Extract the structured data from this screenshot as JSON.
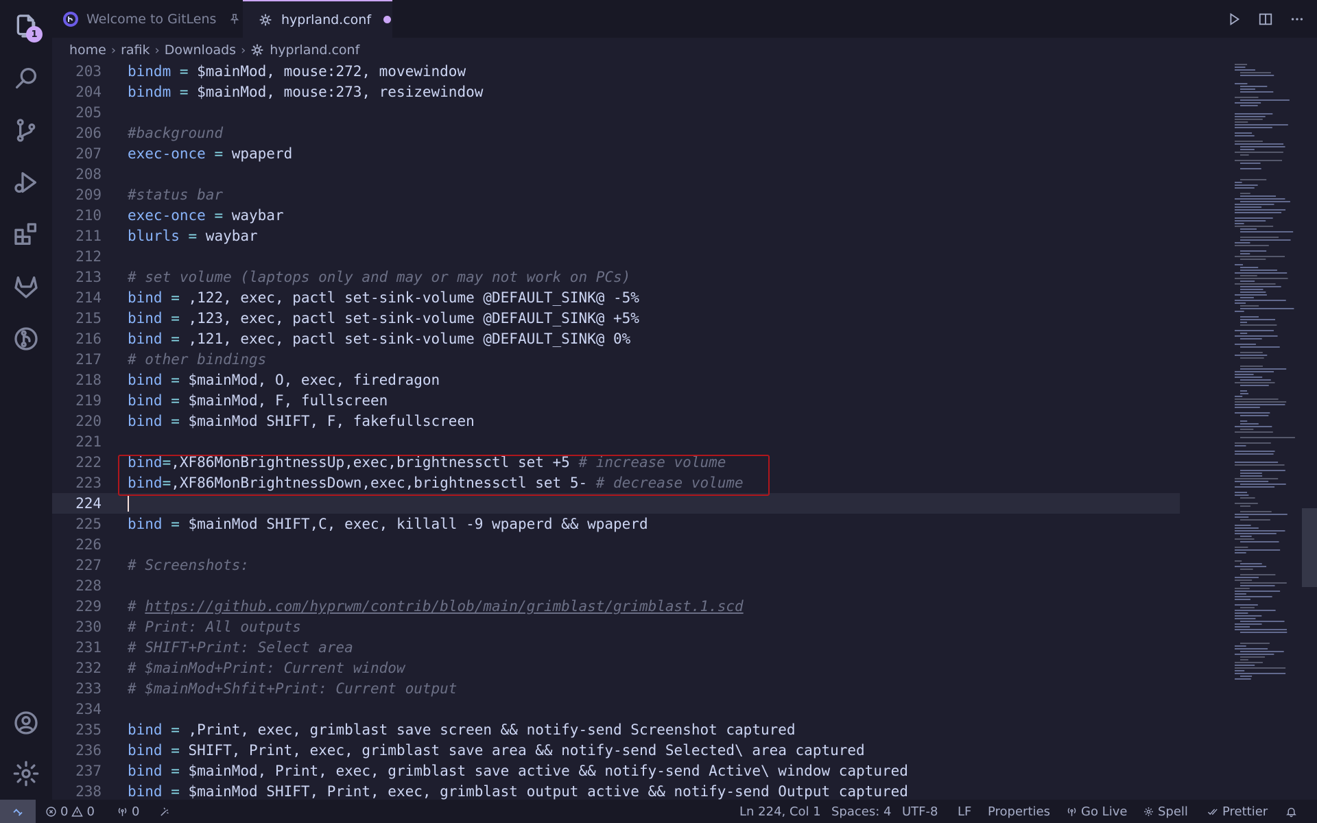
{
  "activity_bar": {
    "items": [
      "explorer",
      "search",
      "source-control",
      "run-and-debug",
      "extensions",
      "gitlab",
      "gitlens",
      "accounts",
      "manage"
    ],
    "explorer_badge": "1"
  },
  "tabs": [
    {
      "label": "Welcome to GitLens",
      "active": false,
      "pinned": true
    },
    {
      "label": "hyprland.conf",
      "active": true,
      "dirty": true
    }
  ],
  "breadcrumb": [
    "home",
    "rafik",
    "Downloads",
    "hyprland.conf"
  ],
  "editor": {
    "current_line": 224,
    "lines": [
      {
        "n": "203",
        "tokens": [
          {
            "t": "bindm",
            "c": "kw"
          },
          {
            "t": " = ",
            "c": "op"
          },
          {
            "t": "$mainMod, mouse:272, movewindow",
            "c": "tx"
          }
        ]
      },
      {
        "n": "204",
        "tokens": [
          {
            "t": "bindm",
            "c": "kw"
          },
          {
            "t": " = ",
            "c": "op"
          },
          {
            "t": "$mainMod, mouse:273, resizewindow",
            "c": "tx"
          }
        ]
      },
      {
        "n": "205",
        "tokens": []
      },
      {
        "n": "206",
        "tokens": [
          {
            "t": "#background",
            "c": "cm"
          }
        ]
      },
      {
        "n": "207",
        "tokens": [
          {
            "t": "exec-once",
            "c": "kw"
          },
          {
            "t": " = ",
            "c": "op"
          },
          {
            "t": "wpaperd",
            "c": "tx"
          }
        ]
      },
      {
        "n": "208",
        "tokens": []
      },
      {
        "n": "209",
        "tokens": [
          {
            "t": "#status bar",
            "c": "cm"
          }
        ]
      },
      {
        "n": "210",
        "tokens": [
          {
            "t": "exec-once",
            "c": "kw"
          },
          {
            "t": " = ",
            "c": "op"
          },
          {
            "t": "waybar",
            "c": "tx"
          }
        ]
      },
      {
        "n": "211",
        "tokens": [
          {
            "t": "blurls",
            "c": "kw"
          },
          {
            "t": " = ",
            "c": "op"
          },
          {
            "t": "waybar",
            "c": "tx"
          }
        ]
      },
      {
        "n": "212",
        "tokens": []
      },
      {
        "n": "213",
        "tokens": [
          {
            "t": "# set volume (laptops only and may or may not work on PCs)",
            "c": "cm"
          }
        ]
      },
      {
        "n": "214",
        "tokens": [
          {
            "t": "bind",
            "c": "kw"
          },
          {
            "t": " = ",
            "c": "op"
          },
          {
            "t": ",122, exec, pactl set-sink-volume @DEFAULT_SINK@ -5%",
            "c": "tx"
          }
        ]
      },
      {
        "n": "215",
        "tokens": [
          {
            "t": "bind",
            "c": "kw"
          },
          {
            "t": " = ",
            "c": "op"
          },
          {
            "t": ",123, exec, pactl set-sink-volume @DEFAULT_SINK@ +5%",
            "c": "tx"
          }
        ]
      },
      {
        "n": "216",
        "tokens": [
          {
            "t": "bind",
            "c": "kw"
          },
          {
            "t": " = ",
            "c": "op"
          },
          {
            "t": ",121, exec, pactl set-sink-volume @DEFAULT_SINK@ 0%",
            "c": "tx"
          }
        ]
      },
      {
        "n": "217",
        "tokens": [
          {
            "t": "# other bindings",
            "c": "cm"
          }
        ]
      },
      {
        "n": "218",
        "tokens": [
          {
            "t": "bind",
            "c": "kw"
          },
          {
            "t": " = ",
            "c": "op"
          },
          {
            "t": "$mainMod, O, exec, firedragon",
            "c": "tx"
          }
        ]
      },
      {
        "n": "219",
        "tokens": [
          {
            "t": "bind",
            "c": "kw"
          },
          {
            "t": " = ",
            "c": "op"
          },
          {
            "t": "$mainMod, F, fullscreen",
            "c": "tx"
          }
        ]
      },
      {
        "n": "220",
        "tokens": [
          {
            "t": "bind",
            "c": "kw"
          },
          {
            "t": " = ",
            "c": "op"
          },
          {
            "t": "$mainMod SHIFT, F, fakefullscreen",
            "c": "tx"
          }
        ]
      },
      {
        "n": "221",
        "tokens": []
      },
      {
        "n": "222",
        "tokens": [
          {
            "t": "bind",
            "c": "kw"
          },
          {
            "t": "=",
            "c": "op"
          },
          {
            "t": ",XF86MonBrightnessUp,exec,brightnessctl set +5 ",
            "c": "tx"
          },
          {
            "t": "# increase volume",
            "c": "cm"
          }
        ]
      },
      {
        "n": "223",
        "tokens": [
          {
            "t": "bind",
            "c": "kw"
          },
          {
            "t": "=",
            "c": "op"
          },
          {
            "t": ",XF86MonBrightnessDown,exec,brightnessctl set 5- ",
            "c": "tx"
          },
          {
            "t": "# decrease volume",
            "c": "cm"
          }
        ]
      },
      {
        "n": "224",
        "tokens": []
      },
      {
        "n": "225",
        "tokens": [
          {
            "t": "bind",
            "c": "kw"
          },
          {
            "t": " = ",
            "c": "op"
          },
          {
            "t": "$mainMod SHIFT,C, exec, killall -9 wpaperd && wpaperd",
            "c": "tx"
          }
        ]
      },
      {
        "n": "226",
        "tokens": []
      },
      {
        "n": "227",
        "tokens": [
          {
            "t": "# Screenshots:",
            "c": "cm"
          }
        ]
      },
      {
        "n": "228",
        "tokens": []
      },
      {
        "n": "229",
        "tokens": [
          {
            "t": "# ",
            "c": "cm"
          },
          {
            "t": "https://github.com/hyprwm/contrib/blob/main/grimblast/grimblast.1.scd",
            "c": "cm ul"
          }
        ]
      },
      {
        "n": "230",
        "tokens": [
          {
            "t": "# Print: All outputs",
            "c": "cm"
          }
        ]
      },
      {
        "n": "231",
        "tokens": [
          {
            "t": "# SHIFT+Print: Select area",
            "c": "cm"
          }
        ]
      },
      {
        "n": "232",
        "tokens": [
          {
            "t": "# $mainMod+Print: Current window",
            "c": "cm"
          }
        ]
      },
      {
        "n": "233",
        "tokens": [
          {
            "t": "# $mainMod+Shfit+Print: Current output",
            "c": "cm"
          }
        ]
      },
      {
        "n": "234",
        "tokens": []
      },
      {
        "n": "235",
        "tokens": [
          {
            "t": "bind",
            "c": "kw"
          },
          {
            "t": " = ",
            "c": "op"
          },
          {
            "t": ",Print, exec, grimblast save screen && notify-send Screenshot captured",
            "c": "tx"
          }
        ]
      },
      {
        "n": "236",
        "tokens": [
          {
            "t": "bind",
            "c": "kw"
          },
          {
            "t": " = ",
            "c": "op"
          },
          {
            "t": "SHIFT, Print, exec, grimblast save area && notify-send Selected\\ area captured",
            "c": "tx"
          }
        ]
      },
      {
        "n": "237",
        "tokens": [
          {
            "t": "bind",
            "c": "kw"
          },
          {
            "t": " = ",
            "c": "op"
          },
          {
            "t": "$mainMod, Print, exec, grimblast save active && notify-send Active\\ window captured",
            "c": "tx"
          }
        ]
      },
      {
        "n": "238",
        "tokens": [
          {
            "t": "bind",
            "c": "kw"
          },
          {
            "t": " = ",
            "c": "op"
          },
          {
            "t": "$mainMod SHIFT, Print, exec, grimblast output active && notify-send Output captured",
            "c": "tx"
          }
        ]
      }
    ]
  },
  "status_bar": {
    "errors": "0",
    "warnings": "0",
    "ports": "0",
    "position": "Ln 224, Col 1",
    "indent": "Spaces: 4",
    "encoding": "UTF-8",
    "eol": "LF",
    "language": "Properties",
    "go_live": "Go Live",
    "spell": "Spell",
    "prettier": "Prettier"
  },
  "colors": {
    "background": "#1e1e2e",
    "accent": "#cba6f7",
    "keyword": "#89b4fa",
    "operator": "#89dceb",
    "comment": "#6c7086",
    "highlight_box": "#b0161c"
  }
}
